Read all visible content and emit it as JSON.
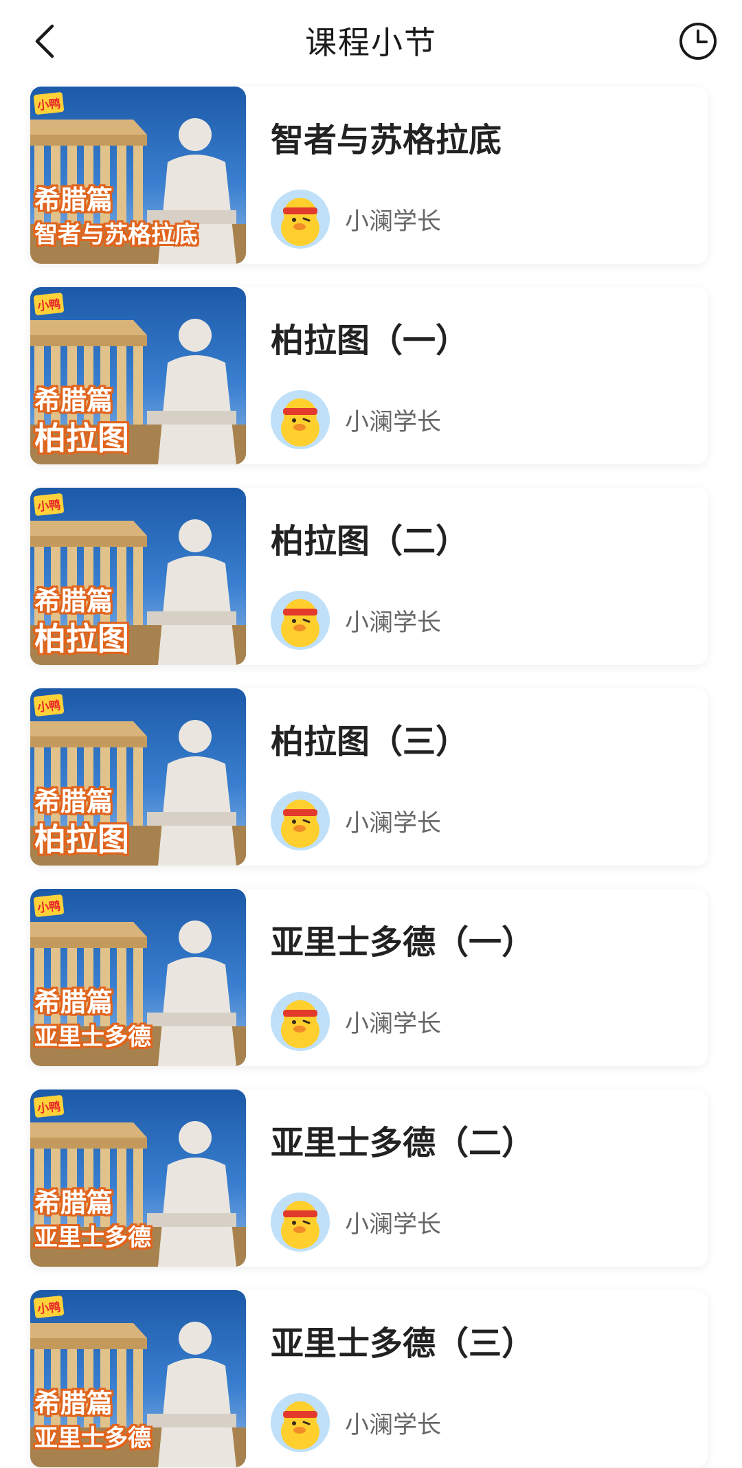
{
  "header": {
    "title": "课程小节",
    "back_icon": "chevron-left-icon",
    "history_icon": "clock-icon"
  },
  "brand_badge": "小鸭",
  "courses": [
    {
      "title": "智者与苏格拉底",
      "author": "小澜学长",
      "thumb_line1": "希腊篇",
      "thumb_line2": "智者与苏格拉底",
      "statue": "socrates"
    },
    {
      "title": "柏拉图（一）",
      "author": "小澜学长",
      "thumb_line1": "希腊篇",
      "thumb_line2": "柏拉图",
      "statue": "plato"
    },
    {
      "title": "柏拉图（二）",
      "author": "小澜学长",
      "thumb_line1": "希腊篇",
      "thumb_line2": "柏拉图",
      "statue": "plato"
    },
    {
      "title": "柏拉图（三）",
      "author": "小澜学长",
      "thumb_line1": "希腊篇",
      "thumb_line2": "柏拉图",
      "statue": "plato"
    },
    {
      "title": "亚里士多德（一）",
      "author": "小澜学长",
      "thumb_line1": "希腊篇",
      "thumb_line2": "亚里士多德",
      "statue": "aristotle"
    },
    {
      "title": "亚里士多德（二）",
      "author": "小澜学长",
      "thumb_line1": "希腊篇",
      "thumb_line2": "亚里士多德",
      "statue": "aristotle"
    },
    {
      "title": "亚里士多德（三）",
      "author": "小澜学长",
      "thumb_line1": "希腊篇",
      "thumb_line2": "亚里士多德",
      "statue": "aristotle"
    }
  ],
  "colors": {
    "caption_outline": "#e1641c",
    "sky": "#2a6bbf",
    "avatar_bg": "#bfe0f8",
    "duck": "#ffcf2e",
    "headband": "#e23a2c"
  }
}
